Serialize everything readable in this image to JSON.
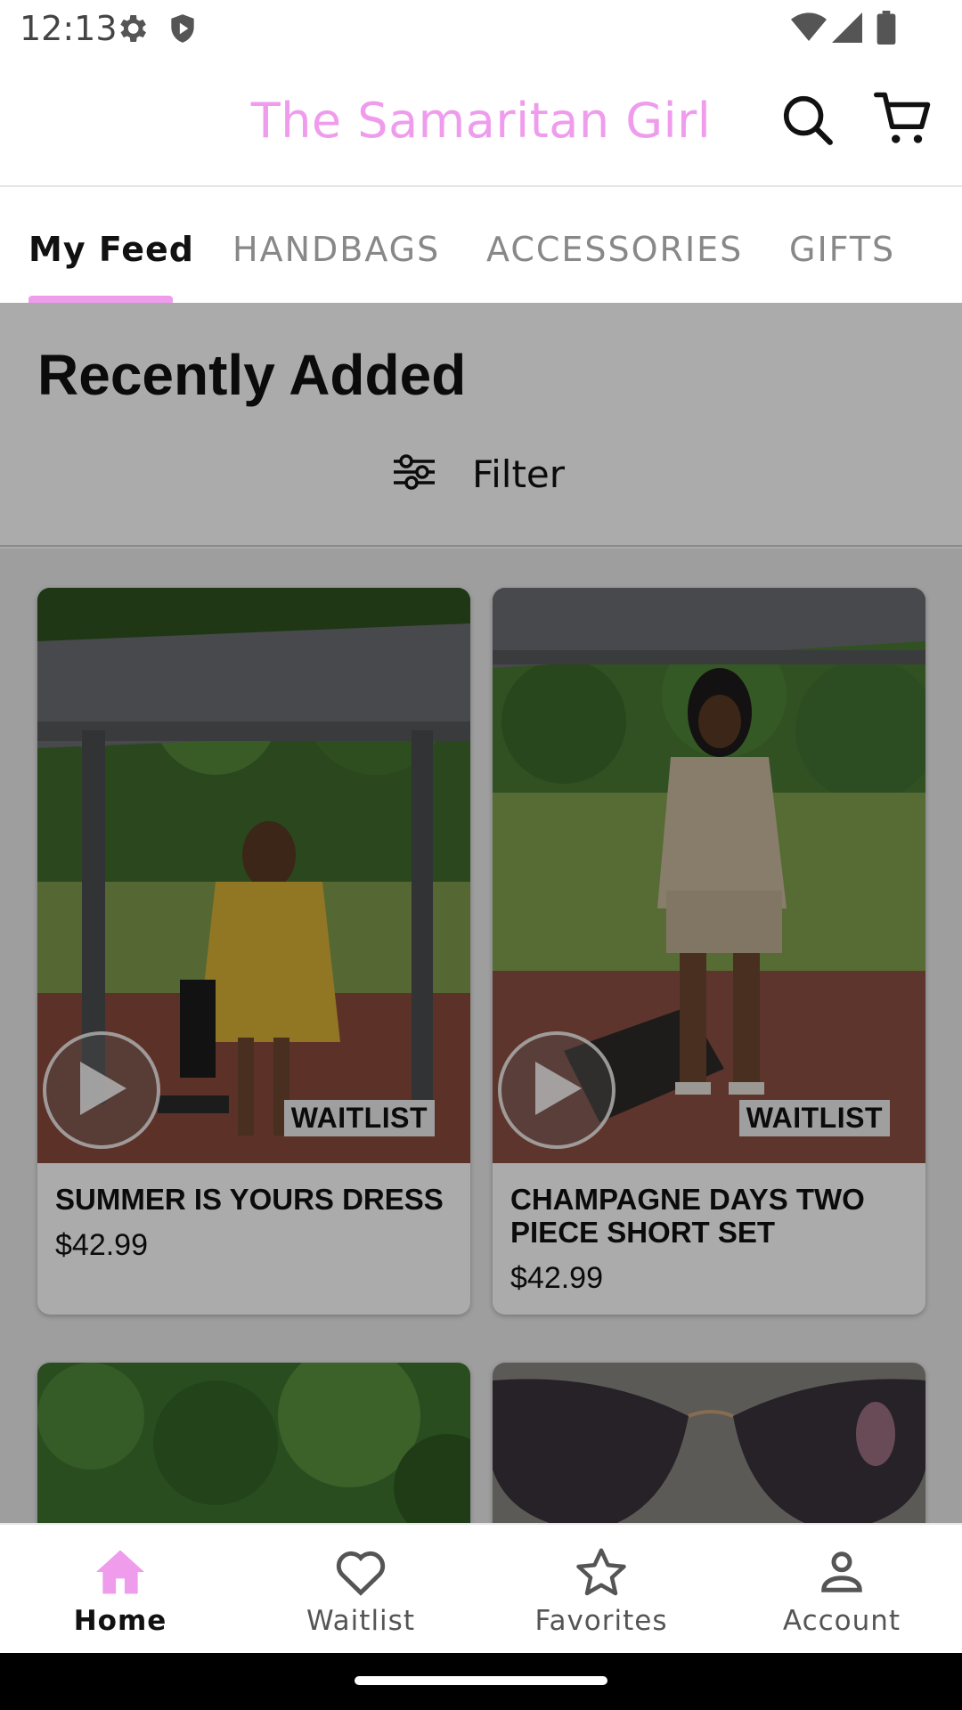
{
  "status_bar": {
    "time": "12:13",
    "icons": [
      "settings-gear-icon",
      "shield-icon",
      "wifi-icon",
      "cell-signal-icon",
      "battery-icon"
    ]
  },
  "header": {
    "title": "The Samaritan Girl",
    "title_color": "#ef9ced",
    "actions": [
      "search-icon",
      "cart-icon"
    ]
  },
  "tabs": {
    "items": [
      {
        "label": "My Feed",
        "active": true
      },
      {
        "label": "HANDBAGS",
        "active": false
      },
      {
        "label": "ACCESSORIES",
        "active": false
      },
      {
        "label": "GIFTS",
        "active": false
      }
    ],
    "indicator_color": "#ef9ced"
  },
  "main": {
    "section_title": "Recently Added",
    "filter_label": "Filter",
    "products": [
      {
        "name": "SUMMER IS YOURS DRESS",
        "price": "$42.99",
        "badge": "WAITLIST"
      },
      {
        "name": "CHAMPAGNE DAYS TWO PIECE SHORT SET",
        "price": "$42.99",
        "badge": "WAITLIST"
      }
    ]
  },
  "bottom_nav": {
    "items": [
      {
        "label": "Home",
        "icon": "home-icon",
        "active": true
      },
      {
        "label": "Waitlist",
        "icon": "heart-icon",
        "active": false
      },
      {
        "label": "Favorites",
        "icon": "star-icon",
        "active": false
      },
      {
        "label": "Account",
        "icon": "person-icon",
        "active": false
      }
    ],
    "active_color": "#ef9ced"
  }
}
